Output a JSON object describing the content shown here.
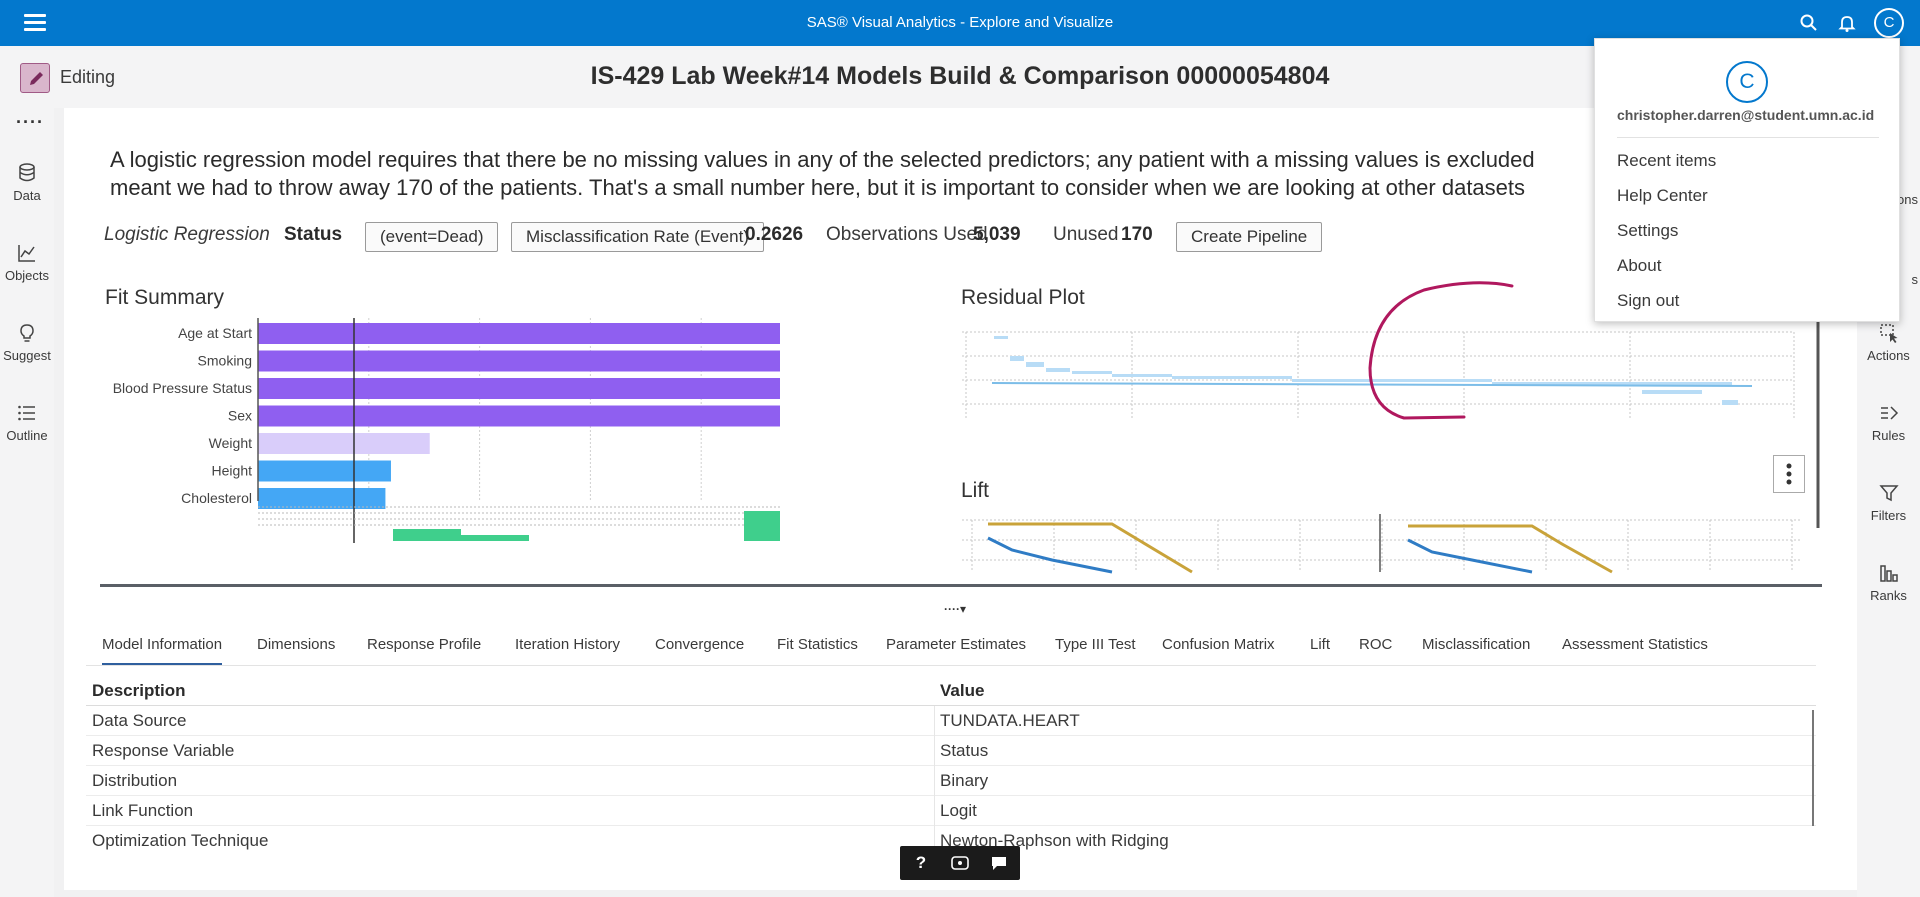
{
  "app": {
    "title": "SAS® Visual Analytics - Explore and Visualize",
    "user_initial": "C"
  },
  "editbar": {
    "mode_label": "Editing",
    "report_title": "IS-429 Lab Week#14 Models Build & Comparison 00000054804"
  },
  "left_nav": {
    "more": "····",
    "items": [
      {
        "label": "Data",
        "icon": "database-icon"
      },
      {
        "label": "Objects",
        "icon": "line-chart-icon"
      },
      {
        "label": "Suggest",
        "icon": "lightbulb-icon"
      },
      {
        "label": "Outline",
        "icon": "list-icon"
      }
    ]
  },
  "right_nav": {
    "partial_labels": [
      "ons",
      "s"
    ],
    "items": [
      {
        "label": "Actions",
        "icon": "cursor-select-icon"
      },
      {
        "label": "Rules",
        "icon": "rules-icon"
      },
      {
        "label": "Filters",
        "icon": "filter-icon"
      },
      {
        "label": "Ranks",
        "icon": "ranks-icon"
      }
    ]
  },
  "description": {
    "line1": "A logistic regression model requires that there be no missing values in any of the selected predictors; any patient with a missing values is excluded",
    "line2": "meant we had to throw away 170 of the patients. That's a small number here, but it is important to consider when we are looking at other datasets"
  },
  "status_row": {
    "model_type": "Logistic Regression",
    "response": "Status",
    "event_pill": "(event=Dead)",
    "metric_pill": "Misclassification Rate (Event)",
    "metric_value": "0.2626",
    "obs_used_label": "Observations Used",
    "obs_used_value": "5,039",
    "unused_label": "Unused",
    "unused_value": "170",
    "pipeline_button": "Create Pipeline"
  },
  "fit_summary": {
    "title": "Fit Summary",
    "variables": [
      "Age at Start",
      "Smoking",
      "Blood Pressure Status",
      "Sex",
      "Weight",
      "Height",
      "Cholesterol"
    ],
    "relative_importance": [
      1.0,
      1.0,
      1.0,
      1.0,
      0.31,
      0.24,
      0.23
    ],
    "colors": [
      "#8f5ff0",
      "#8f5ff0",
      "#8f5ff0",
      "#8f5ff0",
      "#d9cdfa",
      "#44a7f5",
      "#44a7f5"
    ]
  },
  "residual_plot": {
    "title": "Residual Plot"
  },
  "lift": {
    "title": "Lift",
    "colors": {
      "model": "#2f7cc5",
      "best": "#c9a33a"
    }
  },
  "tabs": [
    "Model Information",
    "Dimensions",
    "Response Profile",
    "Iteration History",
    "Convergence",
    "Fit Statistics",
    "Parameter Estimates",
    "Type III Test",
    "Confusion Matrix",
    "Lift",
    "ROC",
    "Misclassification",
    "Assessment Statistics"
  ],
  "table": {
    "headers": [
      "Description",
      "Value"
    ],
    "rows": [
      [
        "Data Source",
        "TUNDATA.HEART"
      ],
      [
        "Response Variable",
        "Status"
      ],
      [
        "Distribution",
        "Binary"
      ],
      [
        "Link Function",
        "Logit"
      ],
      [
        "Optimization Technique",
        "Newton-Raphson with Ridging"
      ]
    ]
  },
  "floatbar": {
    "help": "?",
    "icons": [
      "help-icon",
      "accessibility-icon",
      "comment-icon"
    ]
  },
  "profile_menu": {
    "initial": "C",
    "email": "christopher.darren@student.umn.ac.id",
    "items": [
      "Recent items",
      "Help Center",
      "Settings",
      "About",
      "Sign out"
    ]
  },
  "theme": {
    "brand": "#0378cd",
    "edit_accent": "#a05a86",
    "annotation": "#b0185e"
  }
}
